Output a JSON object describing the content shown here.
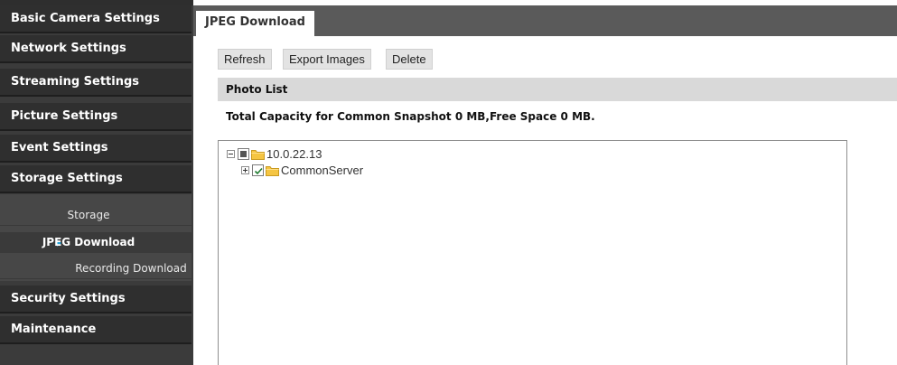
{
  "sidebar": {
    "items": [
      {
        "label": "Basic Camera Settings"
      },
      {
        "label": "Network Settings"
      },
      {
        "label": "Streaming Settings"
      },
      {
        "label": "Picture Settings"
      },
      {
        "label": "Event Settings"
      },
      {
        "label": "Storage Settings"
      },
      {
        "label": "Security Settings"
      },
      {
        "label": "Maintenance"
      }
    ],
    "storage_sub": [
      {
        "label": "Storage"
      },
      {
        "label": "JPEG Download"
      },
      {
        "label": "Recording Download"
      }
    ],
    "active_sub": "JPEG Download"
  },
  "tab": {
    "label": "JPEG Download"
  },
  "toolbar": {
    "refresh_label": "Refresh",
    "export_label": "Export Images",
    "delete_label": "Delete"
  },
  "photo_list": {
    "header": "Photo List",
    "capacity_text": "Total Capacity for Common Snapshot 0 MB,Free Space 0 MB."
  },
  "tree": {
    "root": {
      "label": "10.0.22.13",
      "expanded": true,
      "check_state": "partial"
    },
    "children": [
      {
        "label": "CommonServer",
        "expanded": false,
        "check_state": "checked"
      }
    ]
  },
  "colors": {
    "sidebar_bg": "#2f2f2f",
    "sidebar_sub_bg": "#474747",
    "tabbar_bg": "#5a5a5a",
    "accent_arrow": "#29a3d6",
    "folder_yellow": "#f5c542"
  }
}
